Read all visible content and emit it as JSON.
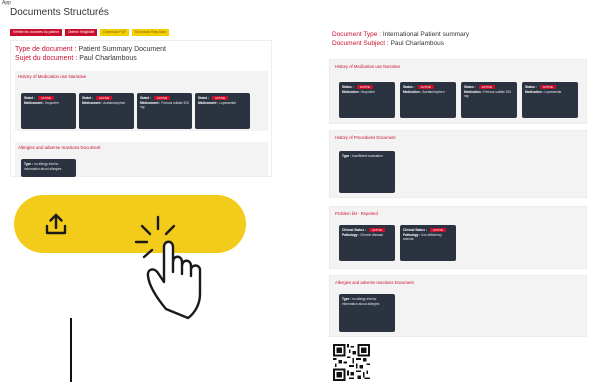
{
  "top_tag": "App",
  "page_title": "Documents Structurés",
  "action_buttons": [
    {
      "label": "Vérifier les données du patient",
      "color": "red"
    },
    {
      "label": "Obtenir l'éligibilité",
      "color": "red"
    },
    {
      "label": "Download PDF",
      "color": "yellow"
    },
    {
      "label": "Download Raw Data",
      "color": "yellow"
    }
  ],
  "left_doc": {
    "type_label": "Type de document : ",
    "type_value": "Patient Summary Document",
    "subject_label": "Sujet du document : ",
    "subject_value": "Paul Charlambous",
    "history_title": "History of Medication use Narrative",
    "medications": [
      {
        "status_label": "Statut :",
        "status": "ACTIVE",
        "key": "Médicament :",
        "value": "Ibuprofen"
      },
      {
        "status_label": "Statut :",
        "status": "ACTIVE",
        "key": "Médicament :",
        "value": "Acetaminophen"
      },
      {
        "status_label": "Statut :",
        "status": "ACTIVE",
        "key": "Médicament :",
        "value": "Ferrous sulfate 325 mg"
      },
      {
        "status_label": "Statut :",
        "status": "ACTIVE",
        "key": "Médicament :",
        "value": "Loperamide"
      }
    ],
    "allergies_title": "Allergies and adverse reactions Document",
    "allergy_card": {
      "key": "Type :",
      "value": "no allergy info/no information about allergies"
    }
  },
  "right_doc": {
    "type_label": "Document Type : ",
    "type_value": "International Patient summary",
    "subject_label": "Document Subject : ",
    "subject_value": "Paul Charlambous",
    "history_title": "History of Medication use Narrative",
    "medications": [
      {
        "status_label": "Status :",
        "status": "ACTIVE",
        "key": "Medication :",
        "value": "Ibuprofen"
      },
      {
        "status_label": "Status :",
        "status": "ACTIVE",
        "key": "Medication :",
        "value": "Acetaminophen"
      },
      {
        "status_label": "Status :",
        "status": "ACTIVE",
        "key": "Medication :",
        "value": "Ferrous sulfate 325 mg"
      },
      {
        "status_label": "Status :",
        "status": "ACTIVE",
        "key": "Medication :",
        "value": "Loperamide"
      }
    ],
    "procedures_title": "History of Procedures Document",
    "procedure_card": {
      "key": "Type :",
      "value": "Insufficient evaluation"
    },
    "problems_title": "Problem list - Reported",
    "problems": [
      {
        "status_label": "Clinical Status :",
        "status": "ACTIVE",
        "key": "Pathology :",
        "value": "Chronic disease"
      },
      {
        "status_label": "Clinical Status :",
        "status": "ACTIVE",
        "key": "Pathology :",
        "value": "Iron deficiency anemia"
      }
    ],
    "allergies_title": "Allergies and adverse reactions Document",
    "allergy_card": {
      "key": "Type :",
      "value": "no allergy info/no information about allergies"
    }
  },
  "colors": {
    "accent": "#c8102e",
    "card": "#2c3340",
    "pill": "#f3cb1a",
    "button_yellow": "#f5d000"
  },
  "icons": {
    "upload": "upload-icon",
    "hand": "pointing-hand-icon",
    "qr": "qr-code-icon"
  }
}
